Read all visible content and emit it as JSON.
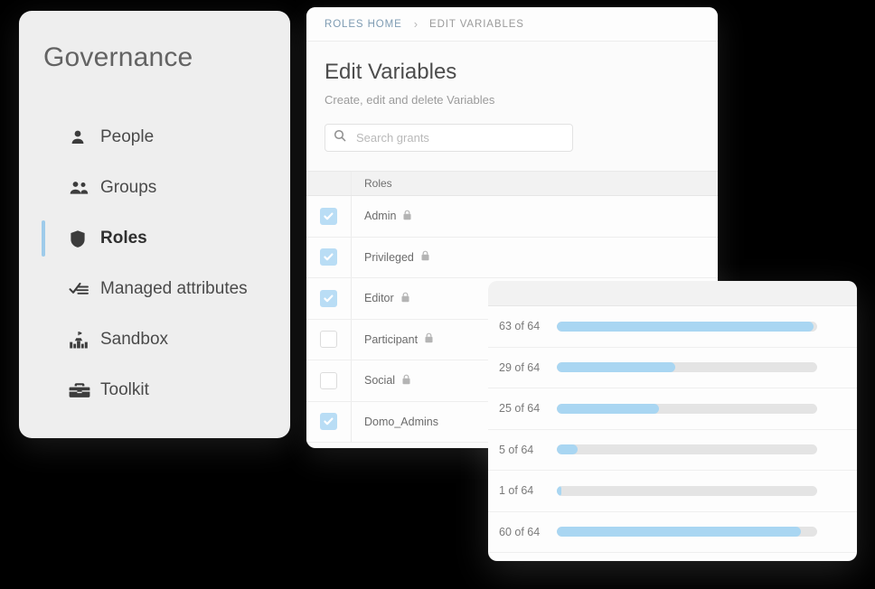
{
  "sidebar": {
    "title": "Governance",
    "items": [
      {
        "label": "People",
        "icon": "person-icon",
        "active": false
      },
      {
        "label": "Groups",
        "icon": "people-group-icon",
        "active": false
      },
      {
        "label": "Roles",
        "icon": "shield-icon",
        "active": true
      },
      {
        "label": "Managed attributes",
        "icon": "checklist-icon",
        "active": false
      },
      {
        "label": "Sandbox",
        "icon": "sandcastle-icon",
        "active": false
      },
      {
        "label": "Toolkit",
        "icon": "toolbox-icon",
        "active": false
      }
    ],
    "accent_color": "#9ecbea"
  },
  "main": {
    "breadcrumb": {
      "home_label": "ROLES HOME",
      "separator": "›",
      "current_label": "EDIT VARIABLES",
      "link_color": "#7f9cb3"
    },
    "title": "Edit Variables",
    "subtitle": "Create, edit and delete Variables",
    "search": {
      "placeholder": "Search grants",
      "value": "",
      "icon": "search-icon"
    },
    "table": {
      "columns": [
        "",
        "Roles"
      ],
      "rows": [
        {
          "name": "Admin",
          "checked": true,
          "locked": true
        },
        {
          "name": "Privileged",
          "checked": true,
          "locked": true
        },
        {
          "name": "Editor",
          "checked": true,
          "locked": true
        },
        {
          "name": "Participant",
          "checked": false,
          "locked": true
        },
        {
          "name": "Social",
          "checked": false,
          "locked": true
        },
        {
          "name": "Domo_Admins",
          "checked": true,
          "locked": false
        }
      ]
    }
  },
  "progress_panel": {
    "total": 64,
    "fill_color": "#a9d6f2",
    "track_color": "#e4e4e4",
    "rows": [
      {
        "label": "63 of 64",
        "value": 63
      },
      {
        "label": "29 of 64",
        "value": 29
      },
      {
        "label": "25 of 64",
        "value": 25
      },
      {
        "label": "5 of 64",
        "value": 5
      },
      {
        "label": "1 of 64",
        "value": 1
      },
      {
        "label": "60 of 64",
        "value": 60
      }
    ]
  },
  "chart_data": {
    "type": "bar",
    "title": "",
    "categories": [
      "63 of 64",
      "29 of 64",
      "25 of 64",
      "5 of 64",
      "1 of 64",
      "60 of 64"
    ],
    "values": [
      63,
      29,
      25,
      5,
      1,
      60
    ],
    "xlabel": "",
    "ylabel": "",
    "ylim": [
      0,
      64
    ]
  }
}
